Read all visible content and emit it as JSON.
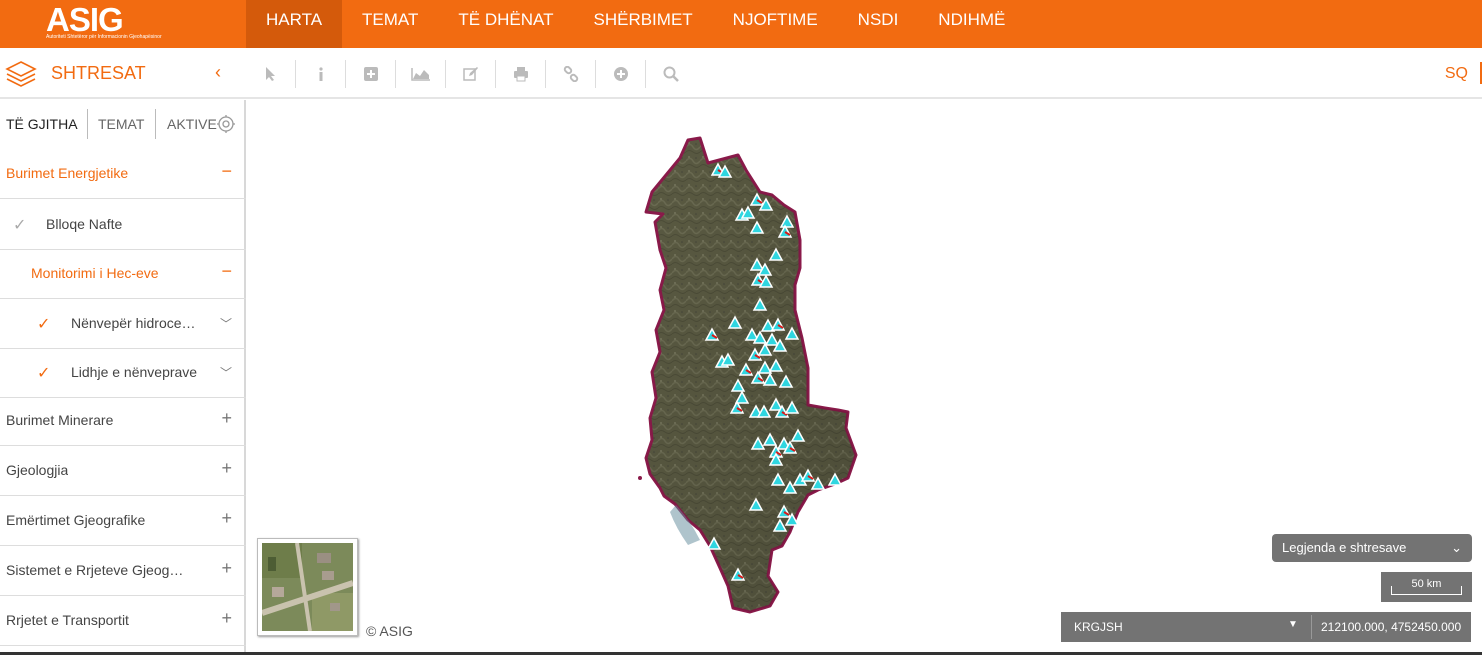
{
  "header": {
    "logo_text": "ASIG",
    "logo_subtitle": "Autoriteti Shtetëror për Informacionin Gjeohapësinor",
    "nav": [
      {
        "label": "HARTA",
        "active": true
      },
      {
        "label": "TEMAT"
      },
      {
        "label": "TË DHËNAT"
      },
      {
        "label": "SHËRBIMET"
      },
      {
        "label": "NJOFTIME"
      },
      {
        "label": "NSDI"
      },
      {
        "label": "NDIHMË"
      }
    ],
    "accent_color": "#f26b11"
  },
  "toolbar": {
    "panel_title": "SHTRESAT",
    "language": "SQ",
    "tools": [
      "pointer-icon",
      "info-icon",
      "plus-square-icon",
      "chart-icon",
      "edit-icon",
      "print-icon",
      "link-icon",
      "plus-circle-icon",
      "search-icon"
    ]
  },
  "sidebar": {
    "tabs": {
      "all": "TË GJITHA",
      "themes": "TEMAT",
      "active": "AKTIVE"
    },
    "items": [
      {
        "label": "Burimet Energjetike",
        "toggle": "−"
      },
      {
        "label": "Blloqe Nafte"
      },
      {
        "label": "Monitorimi i Hec-eve",
        "toggle": "−"
      },
      {
        "label": "Nënvepër hidrocentrale"
      },
      {
        "label": "Lidhje e nënveprave"
      },
      {
        "label": "Burimet Minerare",
        "toggle": "+"
      },
      {
        "label": "Gjeologjia",
        "toggle": "+"
      },
      {
        "label": "Emërtimet Gjeografike",
        "toggle": "+"
      },
      {
        "label": "Sistemet e Rrjeteve Gjeografike",
        "toggle": "+"
      },
      {
        "label": "Rrjetet e Transportit",
        "toggle": "+"
      }
    ]
  },
  "map": {
    "copyright": "© ASIG",
    "legend_label": "Legjenda e shtresave",
    "scale_label": "50 km",
    "crs": "KRGJSH",
    "coordinates": "212100.000, 4752450.000",
    "border_color": "#8a1a4a",
    "marker_color": "#2fd6e0"
  }
}
